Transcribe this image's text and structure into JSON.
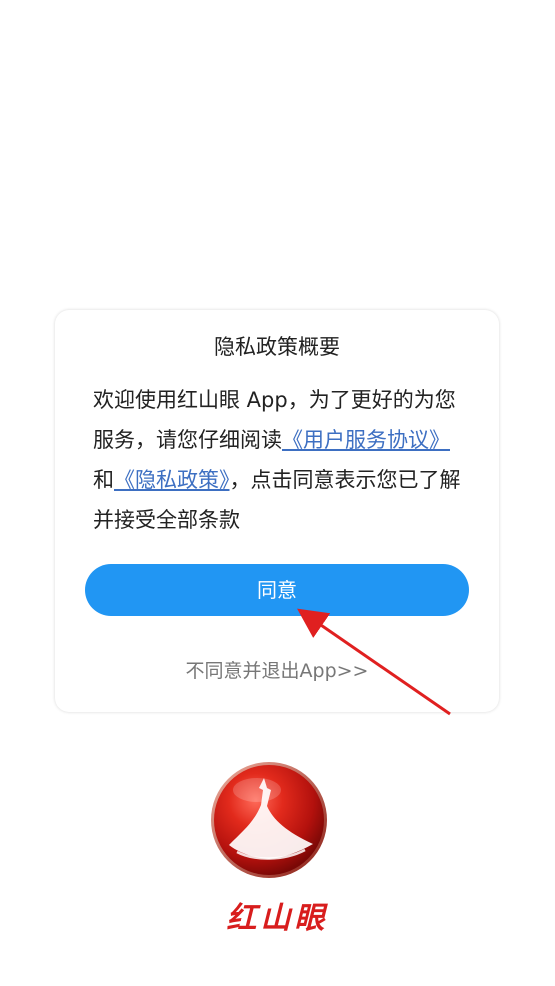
{
  "dialog": {
    "title": "隐私政策概要",
    "body": {
      "intro": "欢迎使用红山眼 App，为了更好的为您服务，请您仔细阅读",
      "user_agreement_link": "《用户服务协议》",
      "and_text": "和",
      "privacy_policy_link": "《隐私政策》",
      "outro": "，点击同意表示您已了解并接受全部条款"
    },
    "agree_button": "同意",
    "disagree_link": "不同意并退出App>>"
  },
  "branding": {
    "app_name": "红山眼",
    "logo_icon": "hongshan-emblem-icon"
  },
  "colors": {
    "accent_blue": "#2196f3",
    "link_blue": "#3d6fc2",
    "brand_red": "#d81d1d",
    "annotation_arrow": "#e02020"
  }
}
